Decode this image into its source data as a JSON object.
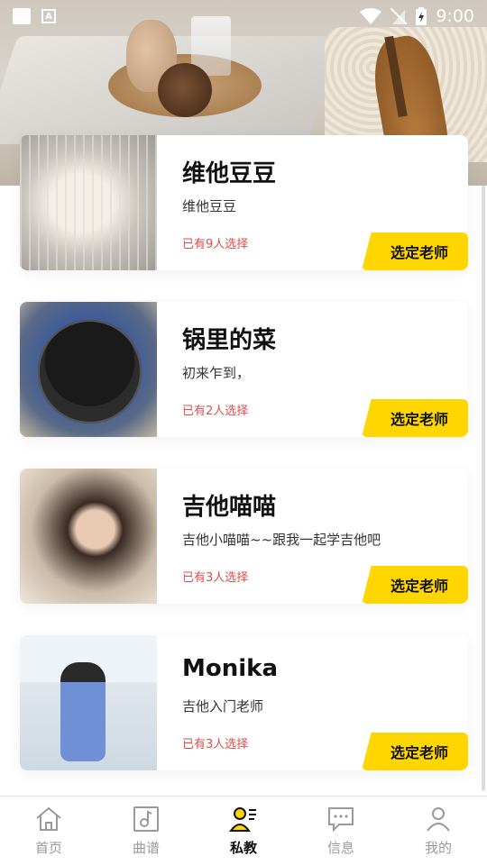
{
  "status_bar": {
    "time": "9:00"
  },
  "teachers": [
    {
      "name": "维他豆豆",
      "description": "维他豆豆",
      "selected_count": "已有9人选择",
      "button_label": "选定老师"
    },
    {
      "name": "锅里的菜",
      "description": "初来乍到，",
      "selected_count": "已有2人选择",
      "button_label": "选定老师"
    },
    {
      "name": "吉他喵喵",
      "description": "吉他小喵喵~~跟我一起学吉他吧",
      "selected_count": "已有3人选择",
      "button_label": "选定老师"
    },
    {
      "name": "Monika",
      "description": "吉他入门老师",
      "selected_count": "已有3人选择",
      "button_label": "选定老师"
    }
  ],
  "tabs": [
    {
      "label": "首页",
      "icon": "home-icon"
    },
    {
      "label": "曲谱",
      "icon": "music-score-icon"
    },
    {
      "label": "私教",
      "icon": "private-tutor-icon",
      "active": true
    },
    {
      "label": "信息",
      "icon": "message-icon"
    },
    {
      "label": "我的",
      "icon": "profile-icon"
    }
  ],
  "colors": {
    "accent": "#ffd600",
    "count_text": "#e34b4b",
    "active_tab": "#111111",
    "inactive_tab": "#9a9a9a"
  }
}
